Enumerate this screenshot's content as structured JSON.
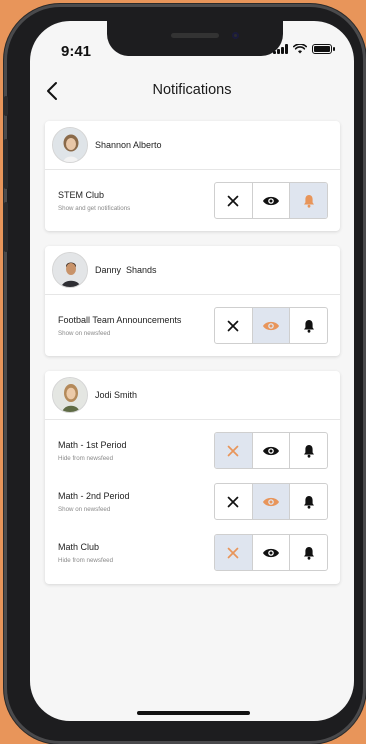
{
  "status_bar": {
    "time": "9:41"
  },
  "header": {
    "title": "Notifications"
  },
  "colors": {
    "accent": "#e8955a",
    "active_bg": "#dfe5ef",
    "inactive_icon": "#111111"
  },
  "cards": [
    {
      "person": "Shannon Alberto",
      "rows": [
        {
          "title": "STEM Club",
          "subtitle": "Show and get notifications",
          "selected": "notify"
        }
      ]
    },
    {
      "person": "Danny  Shands",
      "rows": [
        {
          "title": "Football Team Announcements",
          "subtitle": "Show on newsfeed",
          "selected": "show"
        }
      ]
    },
    {
      "person": "Jodi Smith",
      "rows": [
        {
          "title": "Math - 1st Period",
          "subtitle": "Hide from newsfeed",
          "selected": "hide"
        },
        {
          "title": "Math - 2nd Period",
          "subtitle": "Show on newsfeed",
          "selected": "show"
        },
        {
          "title": "Math Club",
          "subtitle": "Hide from newsfeed",
          "selected": "hide"
        }
      ]
    }
  ]
}
